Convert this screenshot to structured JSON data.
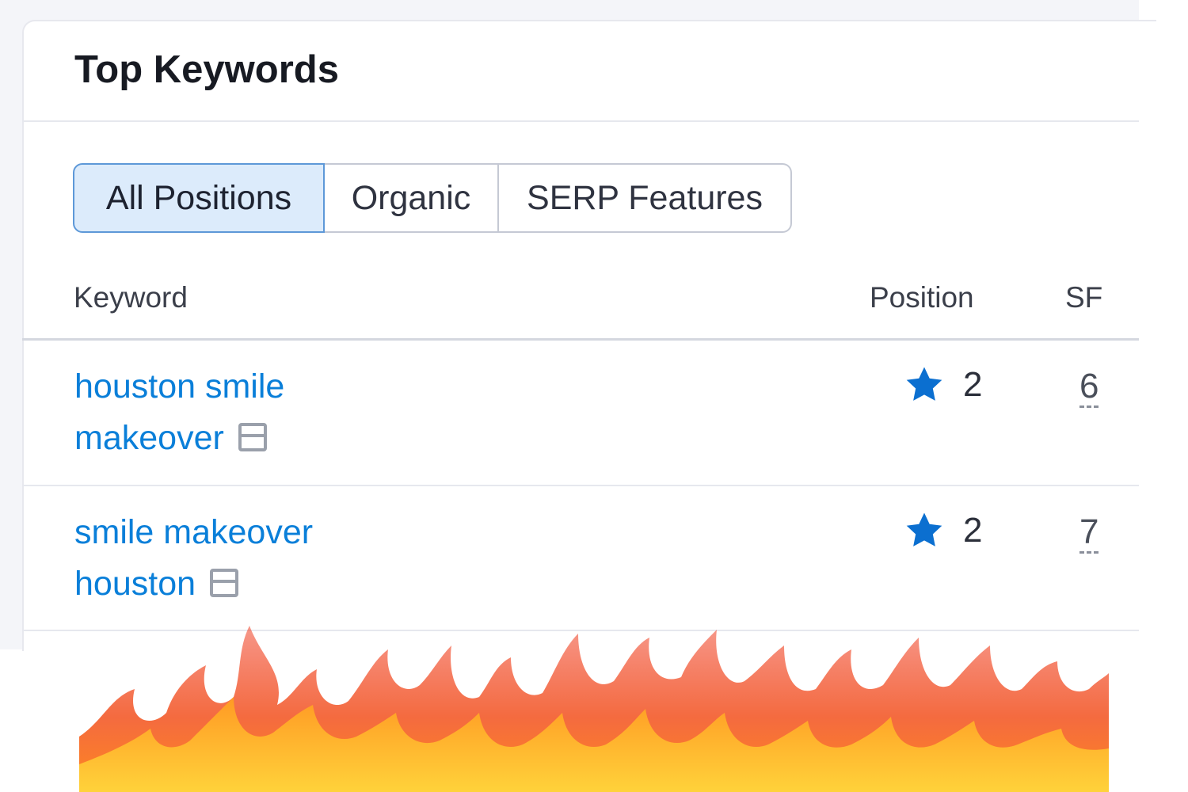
{
  "card": {
    "title": "Top Keywords"
  },
  "tabs": [
    {
      "label": "All Positions",
      "active": true
    },
    {
      "label": "Organic",
      "active": false
    },
    {
      "label": "SERP Features",
      "active": false
    }
  ],
  "table": {
    "headers": {
      "keyword": "Keyword",
      "position": "Position",
      "sf": "SF"
    },
    "rows": [
      {
        "keyword_lines": [
          "houston smile",
          "makeover"
        ],
        "position": "2",
        "sf": "6"
      },
      {
        "keyword_lines": [
          "smile makeover",
          "houston"
        ],
        "position": "2",
        "sf": "7"
      }
    ]
  },
  "colors": {
    "accent": "#0a7fd9",
    "active_tab_bg": "#dcebfb",
    "star": "#0b6fd0",
    "flame_core": "#ffb21e",
    "flame_edge": "#f0442a"
  },
  "icons": {
    "position_marker": "star-icon",
    "keyword_badge": "serp-snippet-icon",
    "decoration": "fire-decoration"
  }
}
